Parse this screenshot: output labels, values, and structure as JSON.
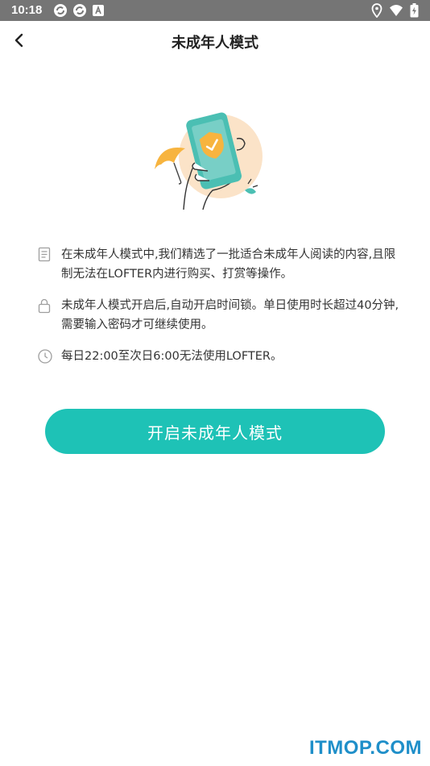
{
  "status_bar": {
    "time": "10:18",
    "icons_left": [
      "sync-icon",
      "sync-icon",
      "notification-a-icon"
    ],
    "icons_right": [
      "location-icon",
      "wifi-icon",
      "battery-charging-icon"
    ]
  },
  "nav": {
    "back_icon": "back-arrow-icon",
    "title": "未成年人模式"
  },
  "illustration": {
    "name": "phone-with-shield-illustration",
    "colors": {
      "teal": "#4bbfb3",
      "orange": "#f7b43f",
      "peach": "#fbe3c8"
    }
  },
  "info": [
    {
      "icon": "document-icon",
      "text": "在未成年人模式中,我们精选了一批适合未成年人阅读的内容,且限制无法在LOFTER内进行购买、打赏等操作。"
    },
    {
      "icon": "lock-icon",
      "text": "未成年人模式开启后,自动开启时间锁。单日使用时长超过40分钟,需要输入密码才可继续使用。"
    },
    {
      "icon": "clock-icon",
      "text": "每日22:00至次日6:00无法使用LOFTER。"
    }
  ],
  "primary_button": {
    "label": "开启未成年人模式",
    "color": "#1ec2b6"
  },
  "watermark": {
    "text": "ITMOP.COM",
    "color": "#1f8fc9"
  }
}
